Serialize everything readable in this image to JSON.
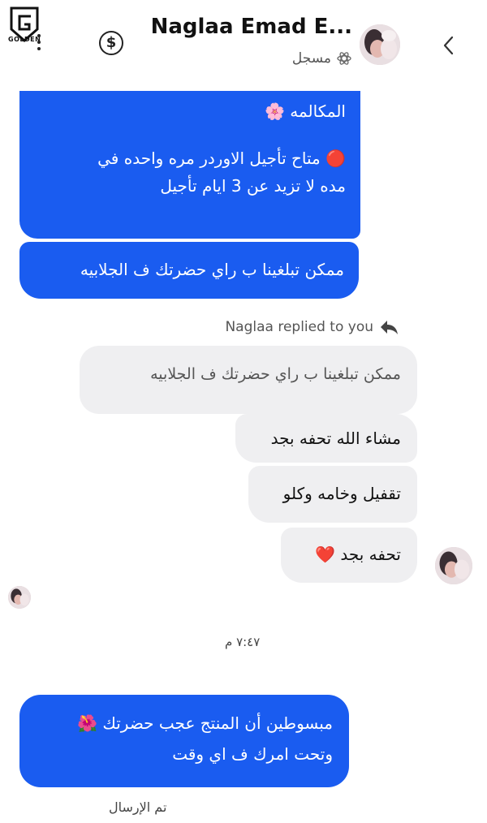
{
  "header": {
    "logo_text": "GOLDEN",
    "contact_name": "Naglaa Emad E...",
    "contact_status": "مسجل"
  },
  "messages": {
    "m1_line1": "المكالمه 🌸",
    "m1_line2": "🔴 متاح تأجيل الاوردر مره واحده في",
    "m1_line3": "مده لا تزيد عن 3 ايام تأجيل",
    "m2": "ممكن تبلغينا ب راي حضرتك ف الجلابيه",
    "reply_note": "Naglaa replied to you",
    "quoted": "ممكن تبلغينا ب راي حضرتك ف الجلابيه",
    "r1": "مشاء الله تحفه بجد",
    "r2": "تقفيل وخامه وكلو",
    "r3": "تحفه بجد ❤️",
    "time": "٧:٤٧ م",
    "m3_line1": "مبسوطين أن المنتج عجب حضرتك 🌺",
    "m3_line2": "وتحت امرك ف اي وقت",
    "sent_status": "تم الإرسال"
  },
  "colors": {
    "outgoing_bubble": "#1a5cf0",
    "incoming_bubble": "#efeff1"
  },
  "icons": [
    "logo-icon",
    "kebab-menu-icon",
    "dollar-icon",
    "back-chevron-icon",
    "atom-icon",
    "reply-arrow-icon"
  ]
}
